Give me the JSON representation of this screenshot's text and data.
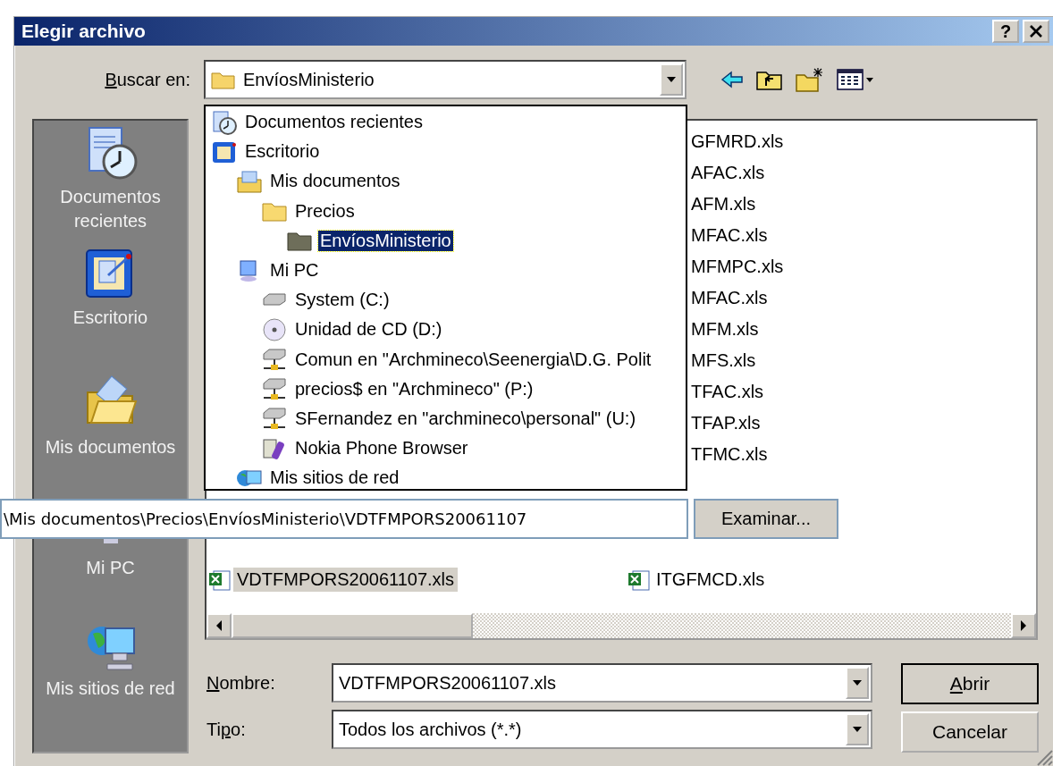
{
  "window": {
    "title": "Elegir archivo",
    "help_label": "?"
  },
  "look_in": {
    "access_key": "B",
    "label_after": "uscar en:",
    "value": "EnvíosMinisterio"
  },
  "places": [
    {
      "kind": "recent",
      "label": "Documentos recientes"
    },
    {
      "kind": "desktop",
      "label": "Escritorio"
    },
    {
      "kind": "mydocs",
      "label": "Mis documentos"
    },
    {
      "kind": "pc",
      "label": "Mi PC"
    },
    {
      "kind": "network",
      "label": "Mis sitios de red"
    }
  ],
  "dropdown": [
    {
      "kind": "recent",
      "label": "Documentos recientes",
      "selected": false
    },
    {
      "kind": "desktop",
      "label": "Escritorio",
      "selected": false,
      "children": [
        {
          "kind": "mydocs",
          "label": "Mis documentos",
          "selected": false,
          "children": [
            {
              "kind": "folder",
              "label": "Precios",
              "selected": false,
              "children": [
                {
                  "kind": "folder-dark",
                  "label": "EnvíosMinisterio",
                  "selected": true
                }
              ]
            }
          ]
        },
        {
          "kind": "pc",
          "label": "Mi PC",
          "selected": false,
          "children": [
            {
              "kind": "drive",
              "label": "System (C:)",
              "selected": false
            },
            {
              "kind": "cd",
              "label": "Unidad de CD (D:)",
              "selected": false
            },
            {
              "kind": "netdrive",
              "label": "Comun en \"Archmineco\\Seenergia\\D.G. Polit",
              "selected": false
            },
            {
              "kind": "netdrive",
              "label": "precios$ en \"Archmineco\" (P:)",
              "selected": false
            },
            {
              "kind": "netdrive",
              "label": "SFernandez en \"archmineco\\personal\" (U:)",
              "selected": false
            },
            {
              "kind": "phone",
              "label": "Nokia Phone Browser",
              "selected": false
            }
          ]
        },
        {
          "kind": "network",
          "label": "Mis sitios de red",
          "selected": false
        }
      ]
    }
  ],
  "files_column_1": [
    "GFMRD.xls",
    "AFAC.xls",
    "AFM.xls",
    "MFAC.xls",
    "MFMPC.xls",
    "MFAC.xls",
    "MFM.xls",
    "MFS.xls",
    "TFAC.xls",
    "TFAP.xls",
    "TFMC.xls"
  ],
  "files_row": [
    {
      "name": "VDTFMPORS20061107.xls",
      "selected": true
    },
    {
      "name": "ITGFMCD.xls",
      "selected": false
    }
  ],
  "path_field": {
    "value": "\\Mis documentos\\Precios\\EnvíosMinisterio\\VDTFMPORS20061107",
    "button": "Examinar..."
  },
  "name_field": {
    "access_key": "N",
    "label_after": "ombre:",
    "value": "VDTFMPORS20061107.xls"
  },
  "type_field": {
    "label_before": "Ti",
    "access_key": "p",
    "label_after": "o:",
    "value": "Todos los archivos (*.*)"
  },
  "buttons": [
    {
      "key": "A",
      "after": "brir",
      "default": true
    },
    {
      "before": "Cancelar",
      "default": false
    }
  ]
}
